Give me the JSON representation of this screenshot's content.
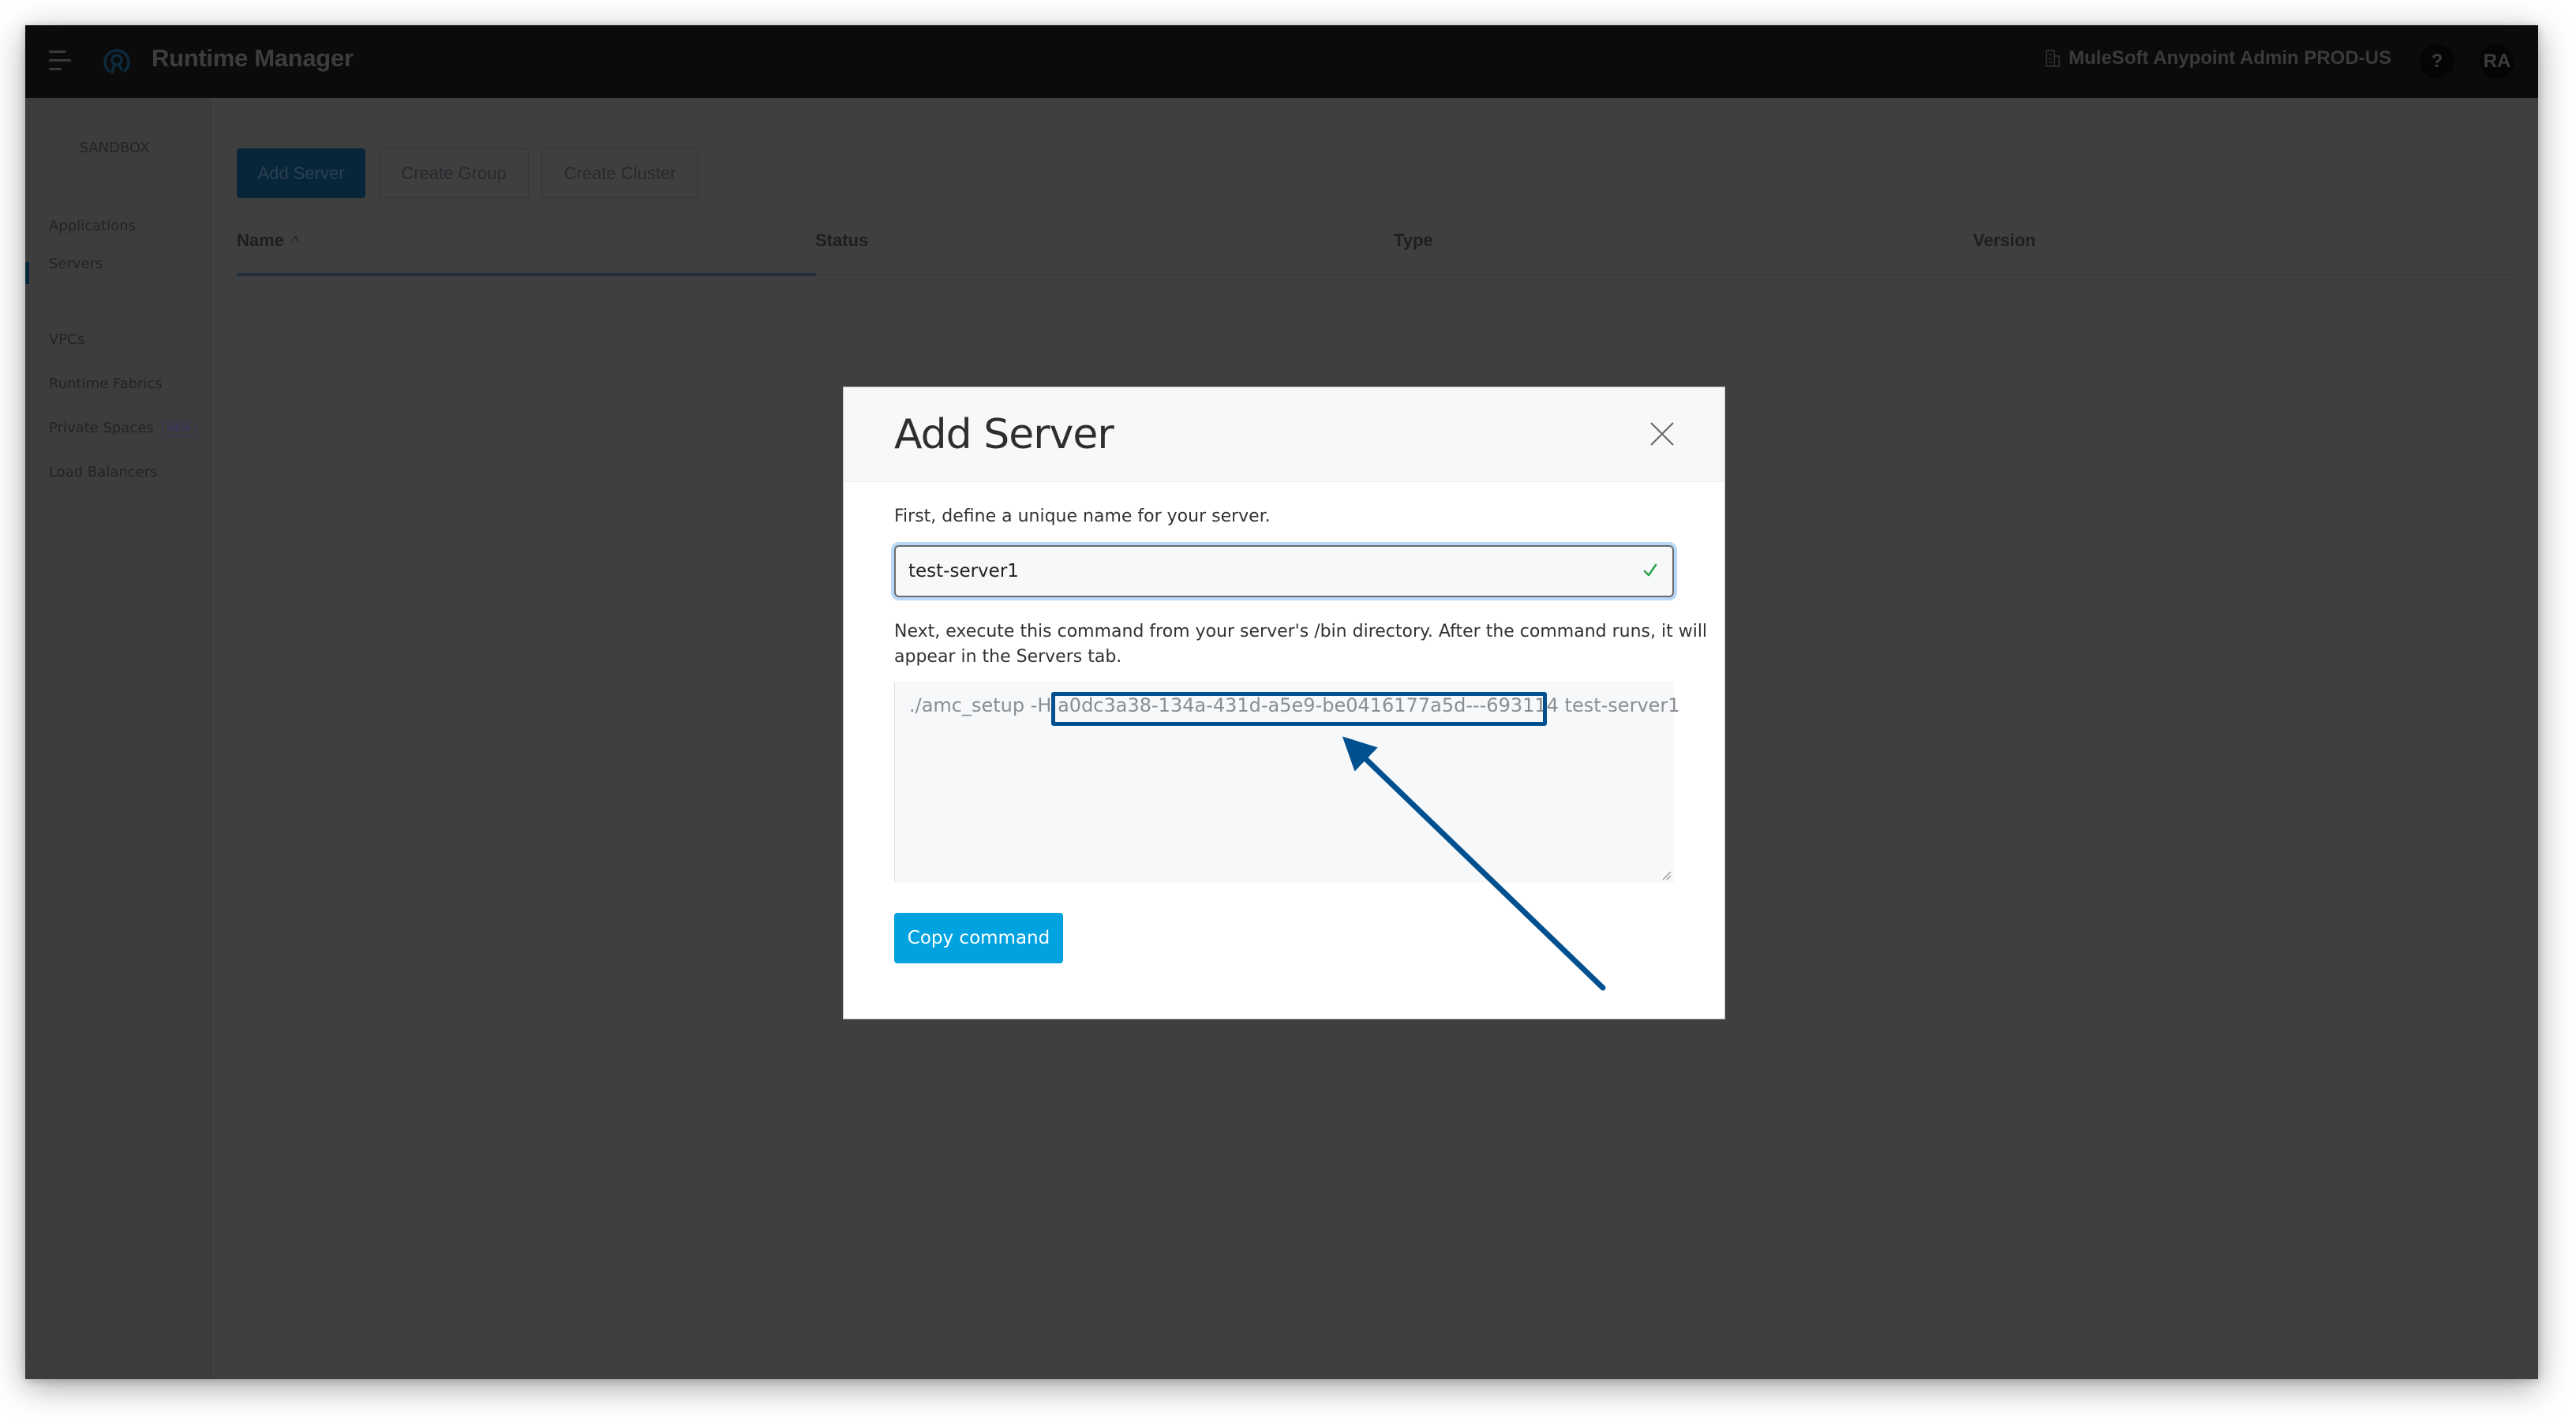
{
  "topnav": {
    "app_title": "Runtime Manager",
    "org_name": "MuleSoft Anypoint Admin PROD-US",
    "help_label": "?",
    "avatar_initials": "RA"
  },
  "sidebar": {
    "environment": "SANDBOX",
    "items": [
      {
        "label": "Applications",
        "active": false
      },
      {
        "label": "Servers",
        "active": true
      },
      {
        "label": "VPCs",
        "active": false
      },
      {
        "label": "Runtime Fabrics",
        "active": false
      },
      {
        "label": "Private Spaces",
        "active": false,
        "badge": "NEW"
      },
      {
        "label": "Load Balancers",
        "active": false
      }
    ]
  },
  "toolbar": {
    "add_server": "Add Server",
    "create_group": "Create Group",
    "create_cluster": "Create Cluster"
  },
  "table": {
    "columns": [
      {
        "label": "Name",
        "sort": "^"
      },
      {
        "label": "Status"
      },
      {
        "label": "Type"
      },
      {
        "label": "Version"
      }
    ],
    "rows": []
  },
  "modal": {
    "title": "Add Server",
    "step1_label": "First, define a unique name for your server.",
    "server_name_value": "test-server1",
    "server_name_valid": true,
    "step2_label_line1": "Next, execute this command from your server's /bin directory. After the command runs, it will",
    "step2_label_line2": "appear in the Servers tab.",
    "command": {
      "prefix": "./amc_setup -H ",
      "token": "a0dc3a38-134a-431d-a5e9-be0416177a5d---693114",
      "suffix": " test-server1"
    },
    "copy_button": "Copy command"
  },
  "annotation": {
    "highlight_target": "registration-token",
    "color": "#00508f"
  },
  "colors": {
    "primary": "#00a2df",
    "valid": "#2ea44f",
    "annotation": "#00508f",
    "focus_ring": "#b7d8f6"
  }
}
